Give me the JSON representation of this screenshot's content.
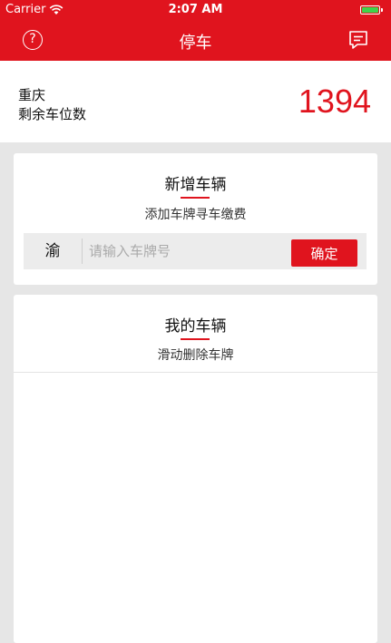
{
  "status_bar": {
    "carrier": "Carrier",
    "time": "2:07 AM",
    "battery_level": 1.0
  },
  "nav": {
    "title": "停车",
    "help_icon": "question-circle-icon",
    "help_glyph": "?",
    "message_icon": "chat-bubble-icon"
  },
  "info": {
    "city": "重庆",
    "spaces_label": "剩余车位数",
    "spaces_count": "1394"
  },
  "add_vehicle": {
    "title": "新增车辆",
    "subtitle": "添加车牌寻车缴费",
    "province": "渝",
    "placeholder": "请输入车牌号",
    "confirm_label": "确定"
  },
  "my_vehicles": {
    "title": "我的车辆",
    "subtitle": "滑动删除车牌",
    "items": []
  },
  "colors": {
    "brand_red": "#e0141e",
    "background": "#e6e6e6",
    "battery_green": "#3fd34b"
  }
}
